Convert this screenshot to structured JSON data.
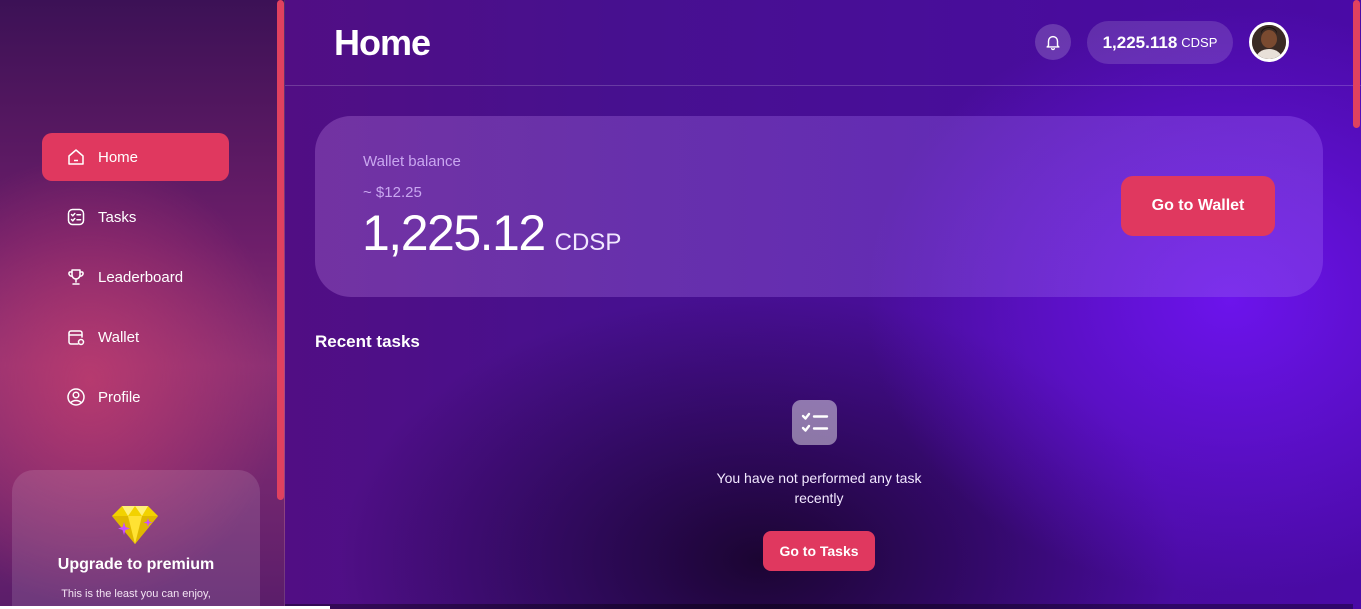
{
  "sidebar": {
    "items": [
      {
        "label": "Home",
        "icon": "home-icon"
      },
      {
        "label": "Tasks",
        "icon": "tasks-icon"
      },
      {
        "label": "Leaderboard",
        "icon": "trophy-icon"
      },
      {
        "label": "Wallet",
        "icon": "wallet-icon"
      },
      {
        "label": "Profile",
        "icon": "user-icon"
      }
    ],
    "active_index": 0,
    "premium": {
      "title": "Upgrade to premium",
      "subtitle": "This is the least you can enjoy,",
      "icon": "diamond-icon"
    }
  },
  "header": {
    "title": "Home",
    "notification_icon": "bell-icon",
    "balance": {
      "amount": "1,225.118",
      "unit": "CDSP"
    },
    "avatar": "user-avatar"
  },
  "wallet": {
    "label": "Wallet balance",
    "usd": "~ $12.25",
    "amount": "1,225.12",
    "unit": "CDSP",
    "button_label": "Go to Wallet"
  },
  "recent": {
    "title": "Recent tasks",
    "empty_message": "You have not performed any task recently",
    "button_label": "Go to Tasks",
    "icon": "checklist-icon"
  },
  "colors": {
    "accent": "#e0385f",
    "wallet_label": "#c9a7f0",
    "background_purple": "#4a0aa6"
  }
}
